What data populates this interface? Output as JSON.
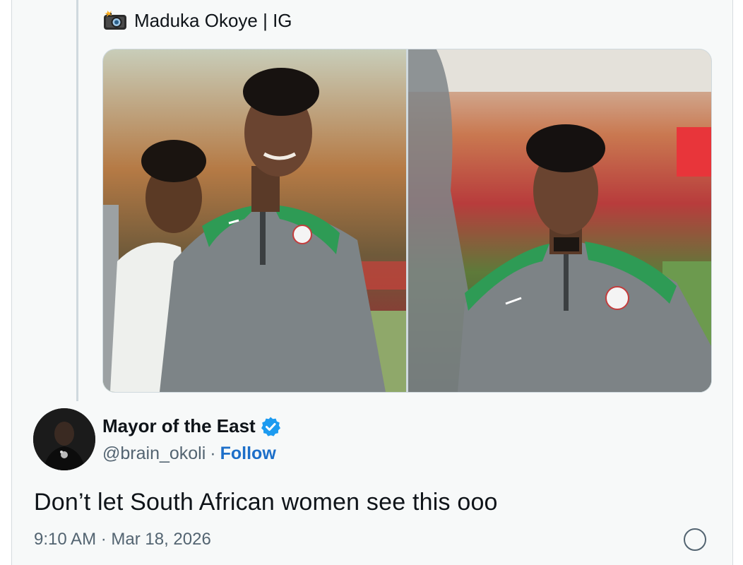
{
  "quoted_post": {
    "header_icon": "camera-flash-icon",
    "header_text": "Maduka Okoye | IG",
    "media": [
      {
        "alt": "photo-1"
      },
      {
        "alt": "photo-2"
      }
    ]
  },
  "post": {
    "author_name": "Mayor of the East",
    "verified": true,
    "handle": "@brain_okoli",
    "separator": "·",
    "follow_label": "Follow",
    "text": "Don’t let South African women see this ooo",
    "timestamp": "9:10 AM · Mar 18, 2026"
  },
  "colors": {
    "accent": "#1d6fc9",
    "verified": "#1d9bf0",
    "muted": "#536471",
    "card_bg": "#f7f9f9"
  }
}
